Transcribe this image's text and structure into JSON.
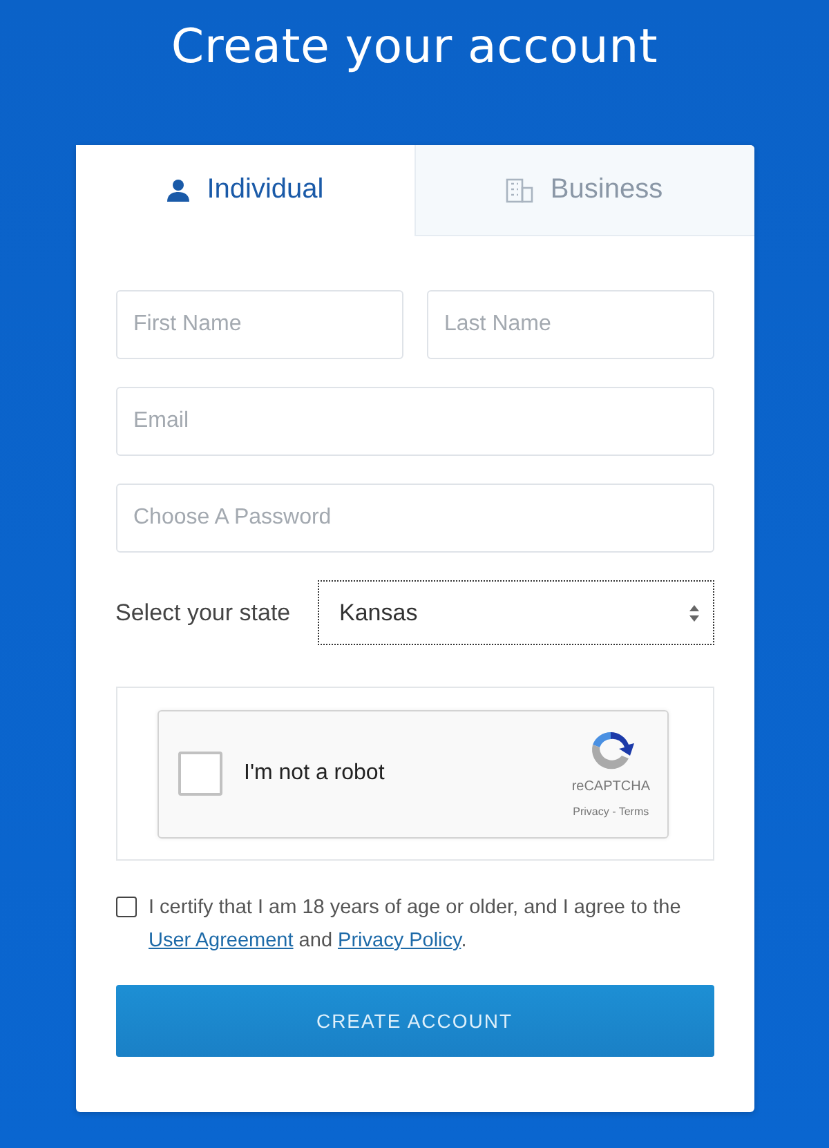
{
  "title": "Create your account",
  "tabs": [
    {
      "label": "Individual",
      "kind": "person",
      "selected": true
    },
    {
      "label": "Business",
      "kind": "building",
      "selected": false
    }
  ],
  "name_fields": [
    {
      "placeholder": "First Name"
    },
    {
      "placeholder": "Last Name"
    }
  ],
  "fields": [
    {
      "placeholder": "Email"
    },
    {
      "placeholder": "Choose A Password"
    }
  ],
  "state_select": {
    "label": "Select your state",
    "value": "Kansas"
  },
  "captcha": {
    "label": "I'm not a robot",
    "checked": false,
    "brand": "reCAPTCHA",
    "privacy": "Privacy",
    "separator": " - ",
    "terms": "Terms"
  },
  "agreement": {
    "checked": false,
    "before": "I certify that I am 18 years of age or older, and I agree to the ",
    "link_1": "User Agreement",
    "between": " and ",
    "link_2": "Privacy Policy",
    "after": "."
  },
  "submit": "CREATE ACCOUNT"
}
